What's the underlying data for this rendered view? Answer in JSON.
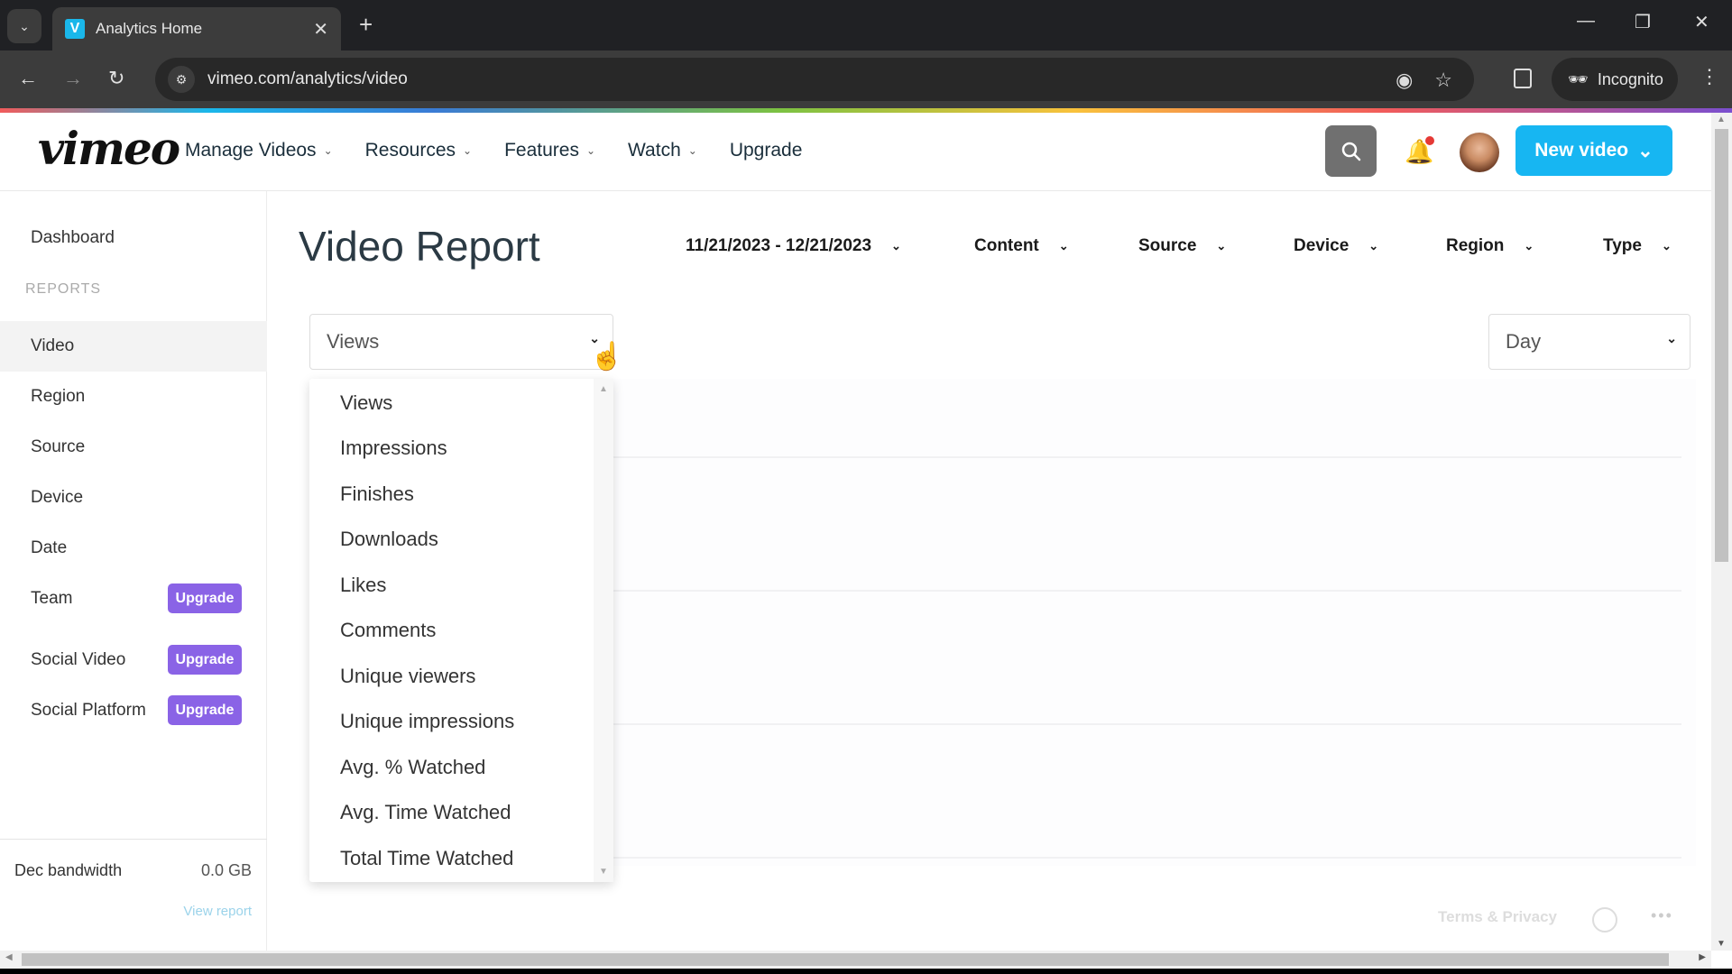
{
  "browser": {
    "tab_title": "Analytics Home",
    "tab_favicon": "V",
    "url": "vimeo.com/analytics/video",
    "incognito_label": "Incognito",
    "icons": [
      "tab-search-icon",
      "close-tab-icon",
      "new-tab-icon",
      "minimize-icon",
      "restore-icon",
      "close-window-icon",
      "back-icon",
      "forward-icon",
      "reload-icon",
      "site-settings-icon",
      "eye-off-icon",
      "star-icon",
      "side-panel-icon",
      "incognito-icon",
      "menu-icon"
    ]
  },
  "header": {
    "logo": "vimeo",
    "nav": [
      {
        "label": "Manage Videos",
        "has_menu": true
      },
      {
        "label": "Resources",
        "has_menu": true
      },
      {
        "label": "Features",
        "has_menu": true
      },
      {
        "label": "Watch",
        "has_menu": true
      },
      {
        "label": "Upgrade",
        "has_menu": false
      }
    ],
    "new_video_label": "New video",
    "notification_dot_color": "#e53935",
    "accent_color": "#17b6f2"
  },
  "sidebar": {
    "dashboard": "Dashboard",
    "section_label": "REPORTS",
    "items": [
      {
        "label": "Video",
        "active": true
      },
      {
        "label": "Region",
        "active": false
      },
      {
        "label": "Source",
        "active": false
      },
      {
        "label": "Device",
        "active": false
      },
      {
        "label": "Date",
        "active": false
      }
    ],
    "upgrade_items": [
      {
        "label": "Team",
        "badge": "Upgrade"
      },
      {
        "label": "Social Video",
        "badge": "Upgrade"
      },
      {
        "label": "Social Platform",
        "badge": "Upgrade"
      }
    ],
    "upgrade_badge_color": "#8a63e6",
    "bandwidth_label": "Dec bandwidth",
    "bandwidth_value": "0.0 GB",
    "view_report": "View report"
  },
  "main": {
    "title": "Video Report",
    "filters": {
      "date_range": "11/21/2023 - 12/21/2023",
      "content": "Content",
      "source": "Source",
      "device": "Device",
      "region": "Region",
      "type": "Type"
    },
    "metric_select": {
      "value": "Views",
      "open": true,
      "options": [
        "Views",
        "Impressions",
        "Finishes",
        "Downloads",
        "Likes",
        "Comments",
        "Unique viewers",
        "Unique impressions",
        "Avg. % Watched",
        "Avg. Time Watched",
        "Total Time Watched"
      ]
    },
    "interval_select": {
      "value": "Day"
    }
  },
  "footer": {
    "terms": "Terms & Privacy"
  }
}
